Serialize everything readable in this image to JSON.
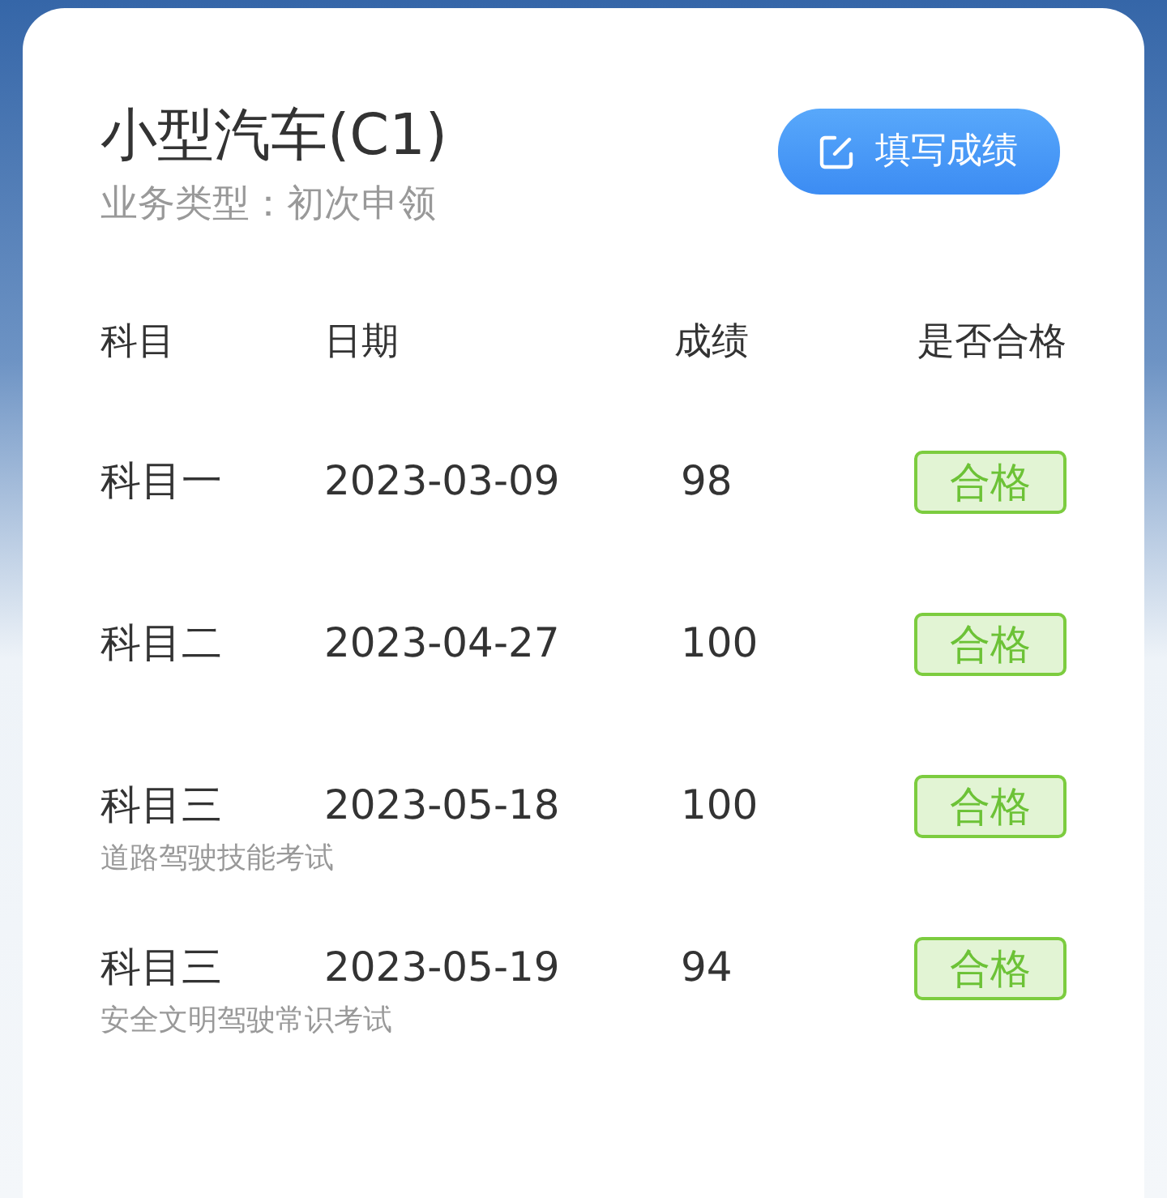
{
  "header": {
    "title": "小型汽车(C1)",
    "subtitle": "业务类型：初次申领",
    "button": "填写成绩"
  },
  "table": {
    "columns": [
      "科目",
      "日期",
      "成绩",
      "是否合格"
    ],
    "rows": [
      {
        "subject": "科目一",
        "date": "2023-03-09",
        "score": "98",
        "result": "合格",
        "passed": true
      },
      {
        "subject": "科目二",
        "date": "2023-04-27",
        "score": "100",
        "result": "合格",
        "passed": true
      },
      {
        "subject": "科目三",
        "note": "道路驾驶技能考试",
        "date": "2023-05-18",
        "score": "100",
        "result": "合格",
        "passed": true
      },
      {
        "subject": "科目三",
        "note": "安全文明驾驶常识考试",
        "date": "2023-05-19",
        "score": "94",
        "result": "合格",
        "passed": true
      }
    ]
  }
}
